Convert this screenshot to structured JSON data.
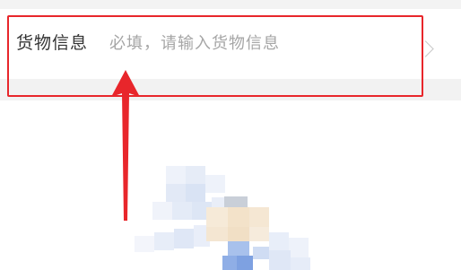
{
  "form": {
    "label": "货物信息",
    "input_value": "",
    "input_placeholder": "必填，请输入货物信息",
    "chevron_icon": "chevron-right-icon"
  },
  "annotation": {
    "highlight_color": "#e8262b",
    "arrow_icon": "arrow-up-icon"
  },
  "illustration": {
    "icon": "pixelated-illustration"
  }
}
